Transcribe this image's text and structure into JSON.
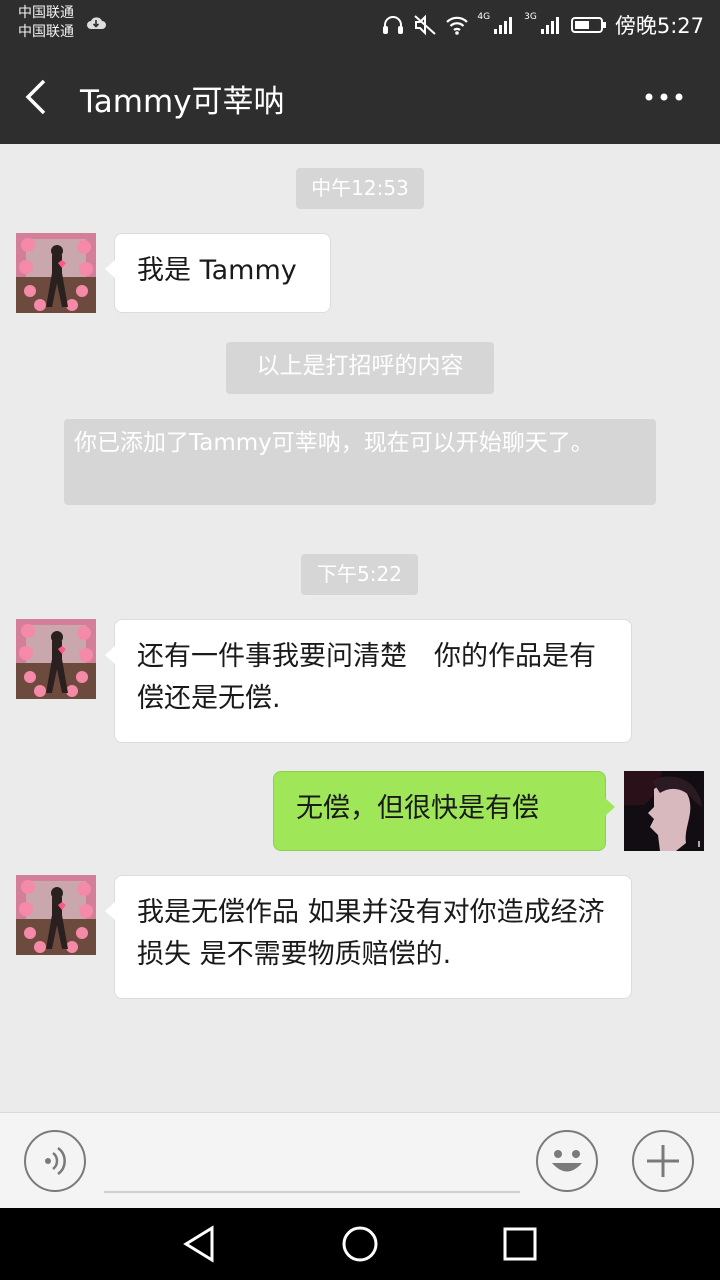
{
  "status_bar": {
    "carrier_1": "中国联通",
    "carrier_2": "中国联通",
    "network_1": "4G",
    "network_2": "3G",
    "time": "傍晚5:27"
  },
  "header": {
    "title": "Tammy可莘呐",
    "back_icon": "chevron-left-icon",
    "more_icon": "more-dots-icon"
  },
  "messages": [
    {
      "kind": "timestamp",
      "text": "中午12:53"
    },
    {
      "kind": "received",
      "text": "我是 Tammy"
    },
    {
      "kind": "system",
      "text": "以上是打招呼的内容"
    },
    {
      "kind": "system",
      "text": "你已添加了Tammy可莘呐，现在可以开始聊天了。"
    },
    {
      "kind": "timestamp",
      "text": "下午5:22"
    },
    {
      "kind": "received",
      "text": "还有一件事我要问清楚　你的作品是有偿还是无偿."
    },
    {
      "kind": "sent",
      "text": "无偿，但很快是有偿"
    },
    {
      "kind": "received",
      "text": "我是无偿作品  如果并没有对你造成经济损失  是不需要物质赔偿的."
    }
  ],
  "input_bar": {
    "voice_icon": "voice-icon",
    "emoji_icon": "emoji-icon",
    "plus_icon": "plus-icon",
    "text_value": ""
  },
  "colors": {
    "bar_bg": "#2e2e2e",
    "chat_bg": "#ebebeb",
    "sent_bubble": "#9fe658",
    "received_bubble": "#ffffff",
    "system_bg": "#d6d6d6"
  }
}
